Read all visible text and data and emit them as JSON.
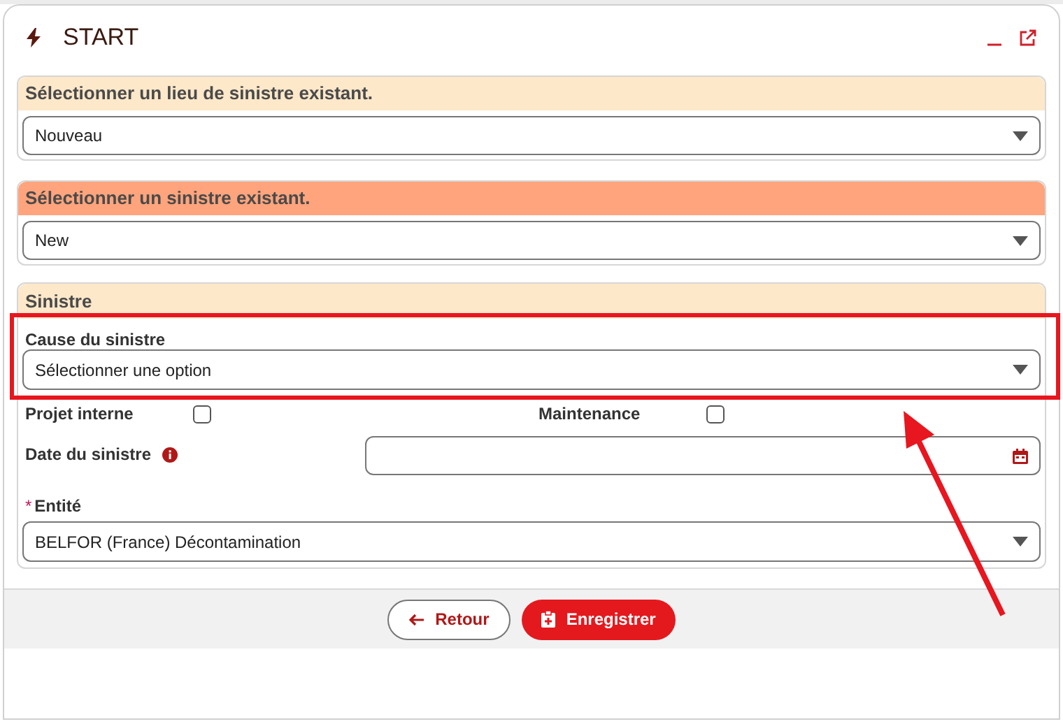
{
  "window": {
    "title": "START"
  },
  "sections": [
    {
      "title": "Sélectionner un lieu de sinistre existant.",
      "kind": "light",
      "select": {
        "value": "Nouveau"
      }
    },
    {
      "title": "Sélectionner un sinistre existant.",
      "kind": "strong",
      "select": {
        "value": "New"
      }
    }
  ],
  "sinistre": {
    "title": "Sinistre",
    "cause": {
      "label": "Cause du sinistre",
      "value": "Sélectionner une option"
    },
    "checkboxes": [
      {
        "label": "Projet interne",
        "checked": false
      },
      {
        "label": "Maintenance",
        "checked": false
      }
    ],
    "date": {
      "label": "Date du sinistre"
    },
    "entity": {
      "required_mark": "*",
      "label": "Entité",
      "value": "BELFOR (France) Décontamination"
    }
  },
  "buttons": [
    {
      "kind": "back",
      "label": "Retour"
    },
    {
      "kind": "save",
      "label": "Enregistrer"
    }
  ]
}
